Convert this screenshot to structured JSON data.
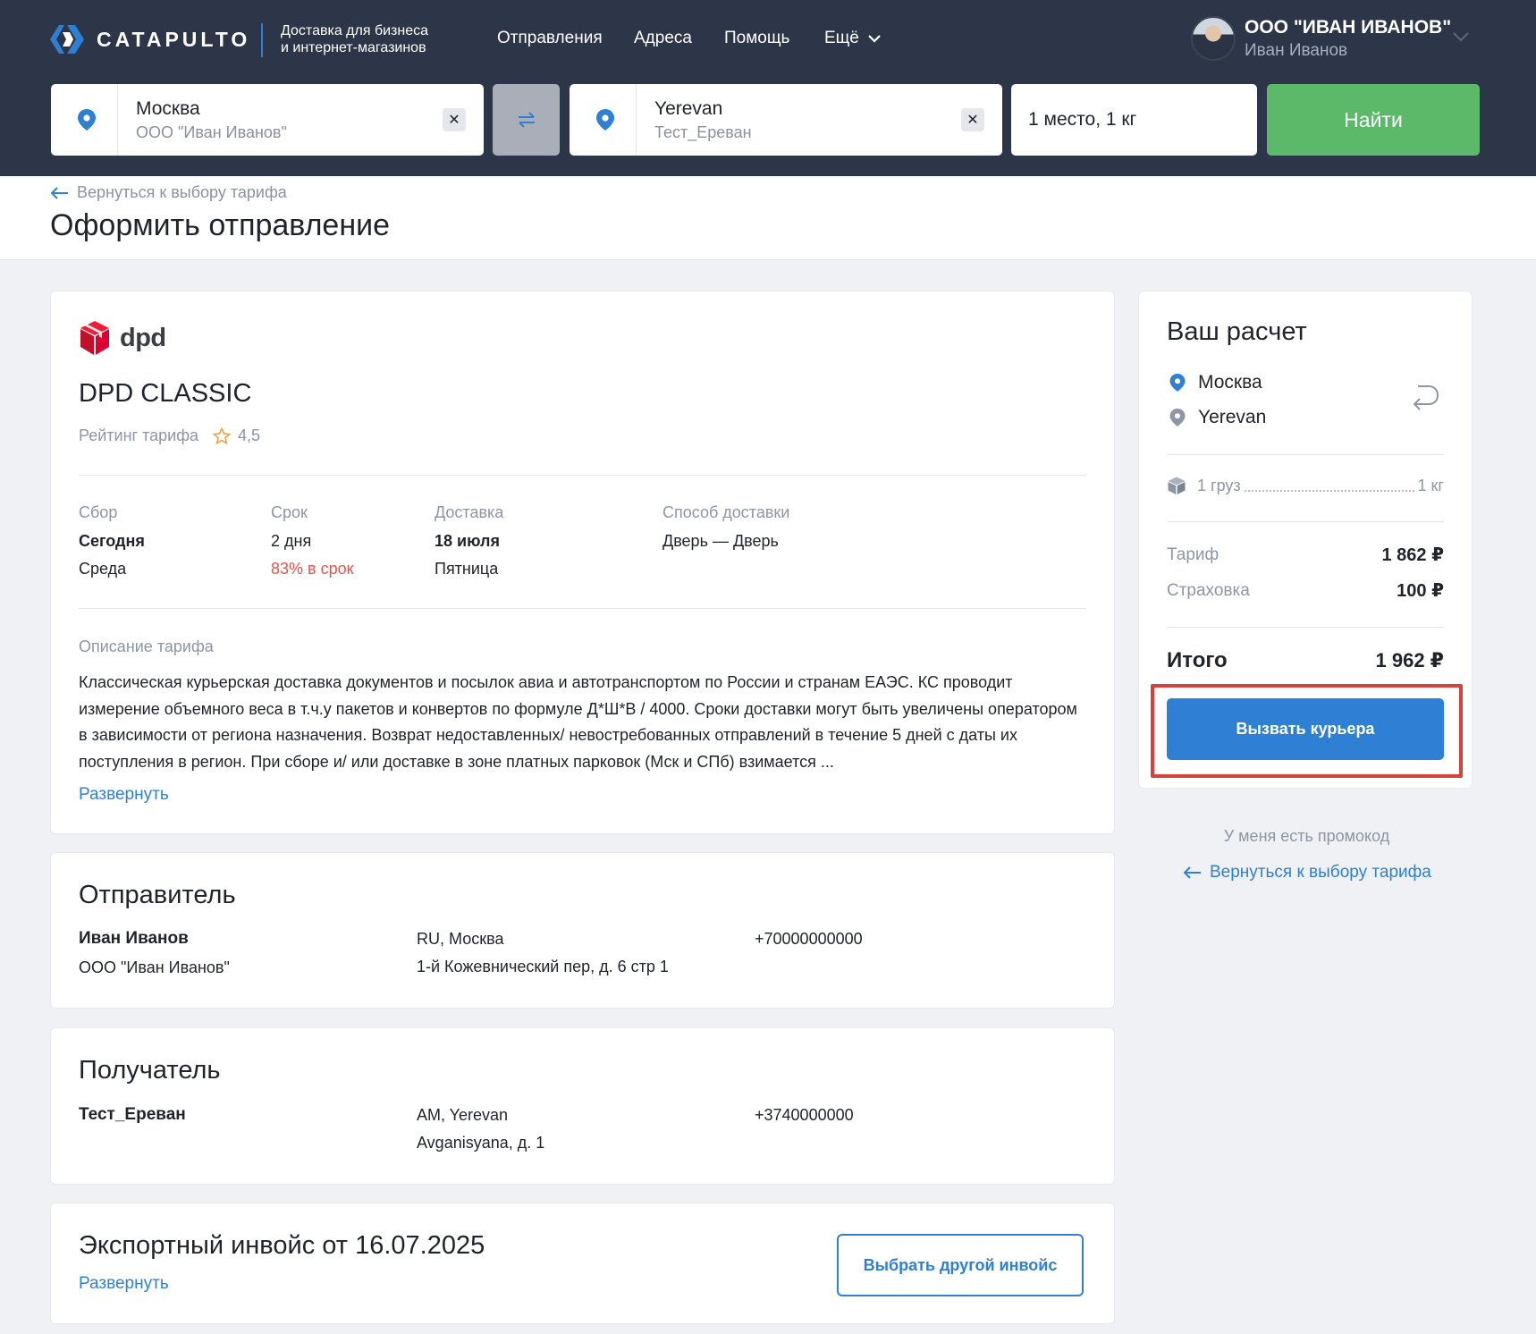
{
  "header": {
    "logo_text": "CATAPULTO",
    "tagline_line1": "Доставка для бизнеса",
    "tagline_line2": "и интернет-магазинов",
    "nav": [
      "Отправления",
      "Адреса",
      "Помощь",
      "Ещё"
    ],
    "account": {
      "company": "ООО \"ИВАН ИВАНОВ\"",
      "user": "Иван Иванов"
    }
  },
  "search": {
    "from": {
      "city": "Москва",
      "org": "ООО \"Иван Иванов\""
    },
    "to": {
      "city": "Yerevan",
      "org": "Тест_Ереван"
    },
    "cargo": "1 место, 1 кг",
    "find_label": "Найти",
    "clear_icon": "✕"
  },
  "page": {
    "back_label": "Вернуться к выбору тарифа",
    "title": "Оформить отправление"
  },
  "tariff": {
    "carrier": "dpd",
    "name": "DPD CLASSIC",
    "rating_label": "Рейтинг тарифа",
    "rating_value": "4,5",
    "columns": {
      "pickup": {
        "label": "Сбор",
        "value": "Сегодня",
        "sub": "Среда"
      },
      "term": {
        "label": "Срок",
        "value": "2 дня",
        "sub": "83% в срок"
      },
      "delivery": {
        "label": "Доставка",
        "value": "18 июля",
        "sub": "Пятница"
      },
      "method": {
        "label": "Способ доставки",
        "value": "Дверь — Дверь"
      }
    },
    "description_label": "Описание тарифа",
    "description": "Классическая курьерская доставка документов и посылок авиа и автотранспортом по России и странам ЕАЭС. КС проводит измерение объемного веса в т.ч.у пакетов и конвертов по формуле Д*Ш*В / 4000. Сроки доставки могут быть увеличены оператором в зависимости от региона назначения. Возврат недоставленных/ невостребованных отправлений в течение 5 дней с даты их поступления в регион. При сборе и/ или доставке в зоне платных парковок (Мск и СПб) взимается ...",
    "expand_label": "Развернуть"
  },
  "sender": {
    "title": "Отправитель",
    "name": "Иван Иванов",
    "org": "ООО \"Иван Иванов\"",
    "location": "RU, Москва",
    "address": "1-й Кожевнический пер, д. 6 стр 1",
    "phone": "+70000000000"
  },
  "recipient": {
    "title": "Получатель",
    "name": "Тест_Ереван",
    "location": "AM, Yerevan",
    "address": "Avganisyana, д. 1",
    "phone": "+3740000000"
  },
  "invoice": {
    "title": "Экспортный инвойс от 16.07.2025",
    "expand_label": "Развернуть",
    "choose_label": "Выбрать другой инвойс"
  },
  "calc": {
    "title": "Ваш расчет",
    "from": "Москва",
    "to": "Yerevan",
    "cargo_label": "1 груз",
    "cargo_weight": "1 кг",
    "tariff_label": "Тариф",
    "tariff_value": "1 862 ₽",
    "insurance_label": "Страховка",
    "insurance_value": "100 ₽",
    "total_label": "Итого",
    "total_value": "1 962 ₽",
    "courier_button": "Вызвать курьера",
    "promo_label": "У меня есть промокод",
    "back_label": "Вернуться к выбору тарифа"
  },
  "colors": {
    "header_bg": "#2d3648",
    "accent_blue": "#2f7fd4",
    "find_green": "#5cb96a",
    "dpd_red": "#dc0032",
    "highlight_red": "#d3423c",
    "late_red": "#e5534b"
  }
}
